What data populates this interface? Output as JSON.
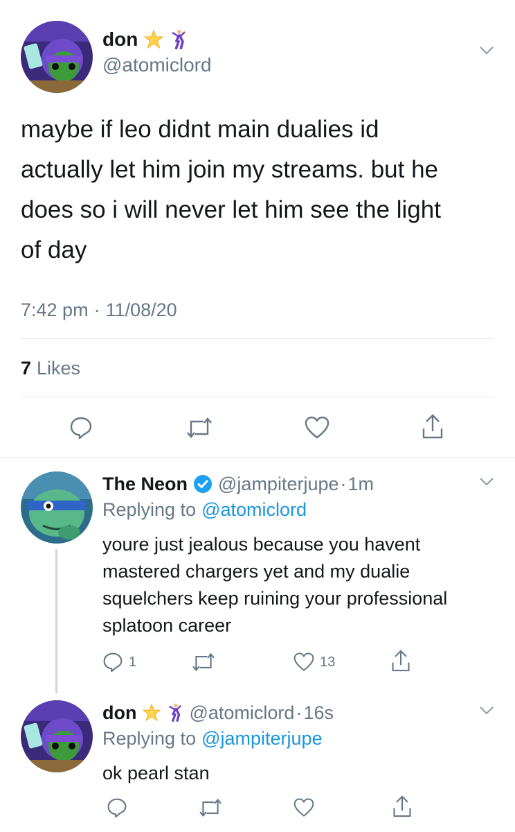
{
  "main_tweet": {
    "author": {
      "name": "don",
      "handle": "@atomiclord",
      "emoji": [
        "star-struck-icon",
        "dancer-icon"
      ]
    },
    "text_lines": [
      "maybe if leo didnt main dualies id",
      "actually let him join my streams. but he",
      "does so i will never let him see the light",
      "of day"
    ],
    "time": "7:42 pm",
    "separator": "·",
    "date": "11/08/20",
    "likes_count": "7",
    "likes_label": "Likes"
  },
  "replies": [
    {
      "author": {
        "name": "The Neon",
        "verified": true,
        "handle": "@jampiterjupe",
        "time": "1m"
      },
      "replying_prefix": "Replying to",
      "replying_to": "@atomiclord",
      "text_lines": [
        "youre just jealous because you havent",
        "mastered chargers yet and my dualie",
        "squelchers keep ruining your professional",
        "splatoon career"
      ],
      "reply_count": "1",
      "retweet_count": "",
      "like_count": "13"
    },
    {
      "author": {
        "name": "don",
        "handle": "@atomiclord",
        "time": "16s",
        "emoji": [
          "star-struck-icon",
          "dancer-icon"
        ]
      },
      "replying_prefix": "Replying to",
      "replying_to": "@jampiterjupe",
      "text_lines": [
        "ok pearl stan"
      ],
      "reply_count": "",
      "retweet_count": "",
      "like_count": ""
    }
  ],
  "colors": {
    "text": "#14171a",
    "muted": "#657786",
    "link": "#1b95e0",
    "divider": "#e1e8ed",
    "verified": "#1da1f2"
  }
}
